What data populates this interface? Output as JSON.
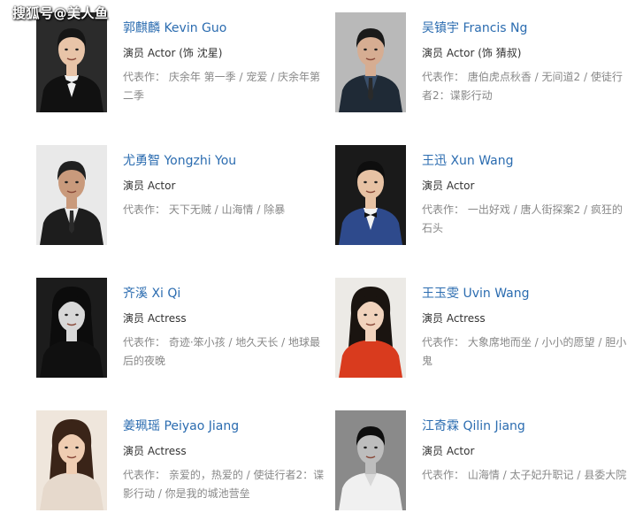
{
  "watermark": "搜狐号@美人鱼",
  "works_label": "代表作：",
  "cast": [
    {
      "name": "郭麒麟 Kevin Guo",
      "role": "演员 Actor (饰 沈星)",
      "works": "庆余年 第一季 / 宠爱 / 庆余年第二季",
      "photo": {
        "bg": "#2b2b2b",
        "skin": "#e8c4a8",
        "hair": "#151515",
        "cloth": "#111111",
        "shirt": "#f2f2f2",
        "style": "tux"
      }
    },
    {
      "name": "吴镇宇 Francis Ng",
      "role": "演员 Actor (饰 猜叔)",
      "works": "唐伯虎点秋香 / 无间道2 / 使徒行者2：谍影行动",
      "photo": {
        "bg": "#b9b9b9",
        "skin": "#d6ad92",
        "hair": "#1a1a1a",
        "cloth": "#1f2a36",
        "shirt": "#3a4f6a",
        "style": "suit"
      }
    },
    {
      "name": "尤勇智 Yongzhi You",
      "role": "演员 Actor",
      "works": "天下无贼 / 山海情 / 除暴",
      "photo": {
        "bg": "#e9e9e9",
        "skin": "#c99a7c",
        "hair": "#202020",
        "cloth": "#1d1d1d",
        "shirt": "#ededed",
        "style": "suit"
      }
    },
    {
      "name": "王迅 Xun Wang",
      "role": "演员 Actor",
      "works": "一出好戏 / 唐人街探案2 / 疯狂的石头",
      "photo": {
        "bg": "#1a1a1a",
        "skin": "#e7c2a4",
        "hair": "#0e0e0e",
        "cloth": "#2e4a8c",
        "shirt": "#f3f3f3",
        "style": "tux"
      }
    },
    {
      "name": "齐溪 Xi Qi",
      "role": "演员 Actress",
      "works": "奇迹·笨小孩 / 地久天长 / 地球最后的夜晚",
      "photo": {
        "bg": "#1c1c1c",
        "skin": "#d8d8d8",
        "hair": "#0c0c0c",
        "cloth": "#101010",
        "shirt": "#101010",
        "style": "dress"
      }
    },
    {
      "name": "王玉雯 Uvin Wang",
      "role": "演员 Actress",
      "works": "大象席地而坐 / 小小的愿望 / 胆小鬼",
      "photo": {
        "bg": "#eceae6",
        "skin": "#f1d3bd",
        "hair": "#1a1410",
        "cloth": "#d93b1e",
        "shirt": "#d93b1e",
        "style": "hoodie"
      }
    },
    {
      "name": "姜珮瑶 Peiyao Jiang",
      "role": "演员 Actress",
      "works": "亲爱的，热爱的 / 使徒行者2：谍影行动 / 你是我的城池营垒",
      "photo": {
        "bg": "#efe6dc",
        "skin": "#efcdb2",
        "hair": "#3a2418",
        "cloth": "#e6d9cc",
        "shirt": "#e6d9cc",
        "style": "dress"
      }
    },
    {
      "name": "江奇霖 Qilin Jiang",
      "role": "演员 Actor",
      "works": "山海情 / 太子妃升职记 / 县委大院",
      "photo": {
        "bg": "#8a8a8a",
        "skin": "#bdbdbd",
        "hair": "#0e0e0e",
        "cloth": "#f0f0f0",
        "shirt": "#f0f0f0",
        "style": "shirt"
      }
    }
  ]
}
